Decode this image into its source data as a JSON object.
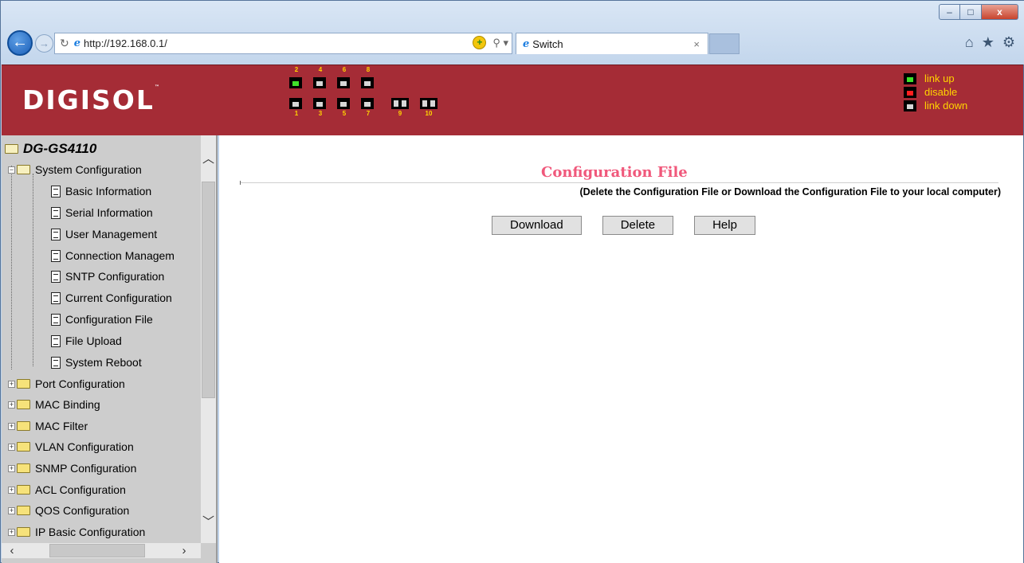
{
  "browser": {
    "address": "http://192.168.0.1/",
    "tab_title": "Switch",
    "window_controls": {
      "minimize": "–",
      "maximize": "□",
      "close": "x"
    }
  },
  "banner": {
    "logo": "DIGISOL",
    "logo_tm": "™",
    "ports_top": [
      {
        "num": "2",
        "status": "up"
      },
      {
        "num": "4",
        "status": "down"
      },
      {
        "num": "6",
        "status": "down"
      },
      {
        "num": "8",
        "status": "down"
      }
    ],
    "ports_bottom": [
      {
        "num": "1",
        "status": "down"
      },
      {
        "num": "3",
        "status": "down"
      },
      {
        "num": "5",
        "status": "down"
      },
      {
        "num": "7",
        "status": "down"
      }
    ],
    "sfp_ports": [
      "9",
      "10"
    ],
    "legend": [
      {
        "label": "link up",
        "status": "up"
      },
      {
        "label": "disable",
        "status": "dis"
      },
      {
        "label": "link down",
        "status": "down"
      }
    ],
    "colors": {
      "background": "#a52c36",
      "legend_text": "#ffd400",
      "up": "#3fe22a",
      "disable": "#ff1f1f"
    }
  },
  "sidebar": {
    "root": "DG-GS4110",
    "system_configuration": {
      "label": "System Configuration",
      "items": [
        "Basic Information",
        "Serial Information",
        "User Management",
        "Connection Managem",
        "SNTP Configuration",
        "Current Configuration",
        "Configuration File",
        "File Upload",
        "System Reboot"
      ]
    },
    "folders": [
      "Port Configuration",
      "MAC Binding",
      "MAC Filter",
      "VLAN Configuration",
      "SNMP Configuration",
      "ACL Configuration",
      "QOS Configuration",
      "IP Basic Configuration"
    ]
  },
  "main": {
    "title": "Configuration File",
    "subtitle": "(Delete the Configuration File or Download the Configuration File to your local computer)",
    "buttons": {
      "download": "Download",
      "delete": "Delete",
      "help": "Help"
    },
    "title_color": "#f0587b"
  }
}
